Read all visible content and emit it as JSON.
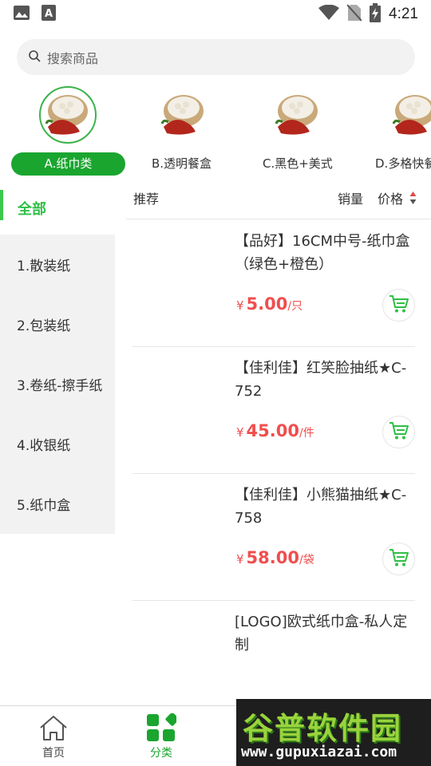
{
  "status_bar": {
    "time": "4:21",
    "icons": [
      "image-icon",
      "font-a-icon",
      "wifi-icon",
      "no-sim-icon",
      "battery-charging-icon"
    ]
  },
  "search": {
    "placeholder": "搜索商品",
    "icon": "search-icon"
  },
  "categories": [
    {
      "label": "A.纸巾类",
      "active": true
    },
    {
      "label": "B.透明餐盒",
      "active": false
    },
    {
      "label": "C.黑色+美式",
      "active": false
    },
    {
      "label": "D.多格快餐",
      "active": false
    }
  ],
  "sort": {
    "recommend": "推荐",
    "sales": "销量",
    "price": "价格"
  },
  "side_menu": {
    "all": "全部",
    "items": [
      "1.散装纸",
      "2.包装纸",
      "3.卷纸-擦手纸",
      "4.收银纸",
      "5.纸巾盒"
    ]
  },
  "products": [
    {
      "name": "【品好】16CM中号-纸巾盒（绿色+橙色）",
      "currency": "¥",
      "price": "5.00",
      "unit": "/只"
    },
    {
      "name": "【佳利佳】红笑脸抽纸★C-752",
      "currency": "¥",
      "price": "45.00",
      "unit": "/件"
    },
    {
      "name": "【佳利佳】小熊猫抽纸★C-758",
      "currency": "¥",
      "price": "58.00",
      "unit": "/袋"
    },
    {
      "name": "[LOGO]欧式纸巾盒-私人定制",
      "currency": "",
      "price": "",
      "unit": ""
    }
  ],
  "bottom_nav": [
    {
      "label": "首页",
      "icon": "home-icon",
      "active": false
    },
    {
      "label": "分类",
      "icon": "category-grid-icon",
      "active": true
    }
  ],
  "watermark": {
    "title": "谷普软件园",
    "url": "www.gupuxiazai.com"
  },
  "colors": {
    "accent_green": "#1aa52f",
    "side_active_green": "#2fbf46",
    "price_red": "#f04e4e",
    "side_bg": "#f2f2f2"
  }
}
